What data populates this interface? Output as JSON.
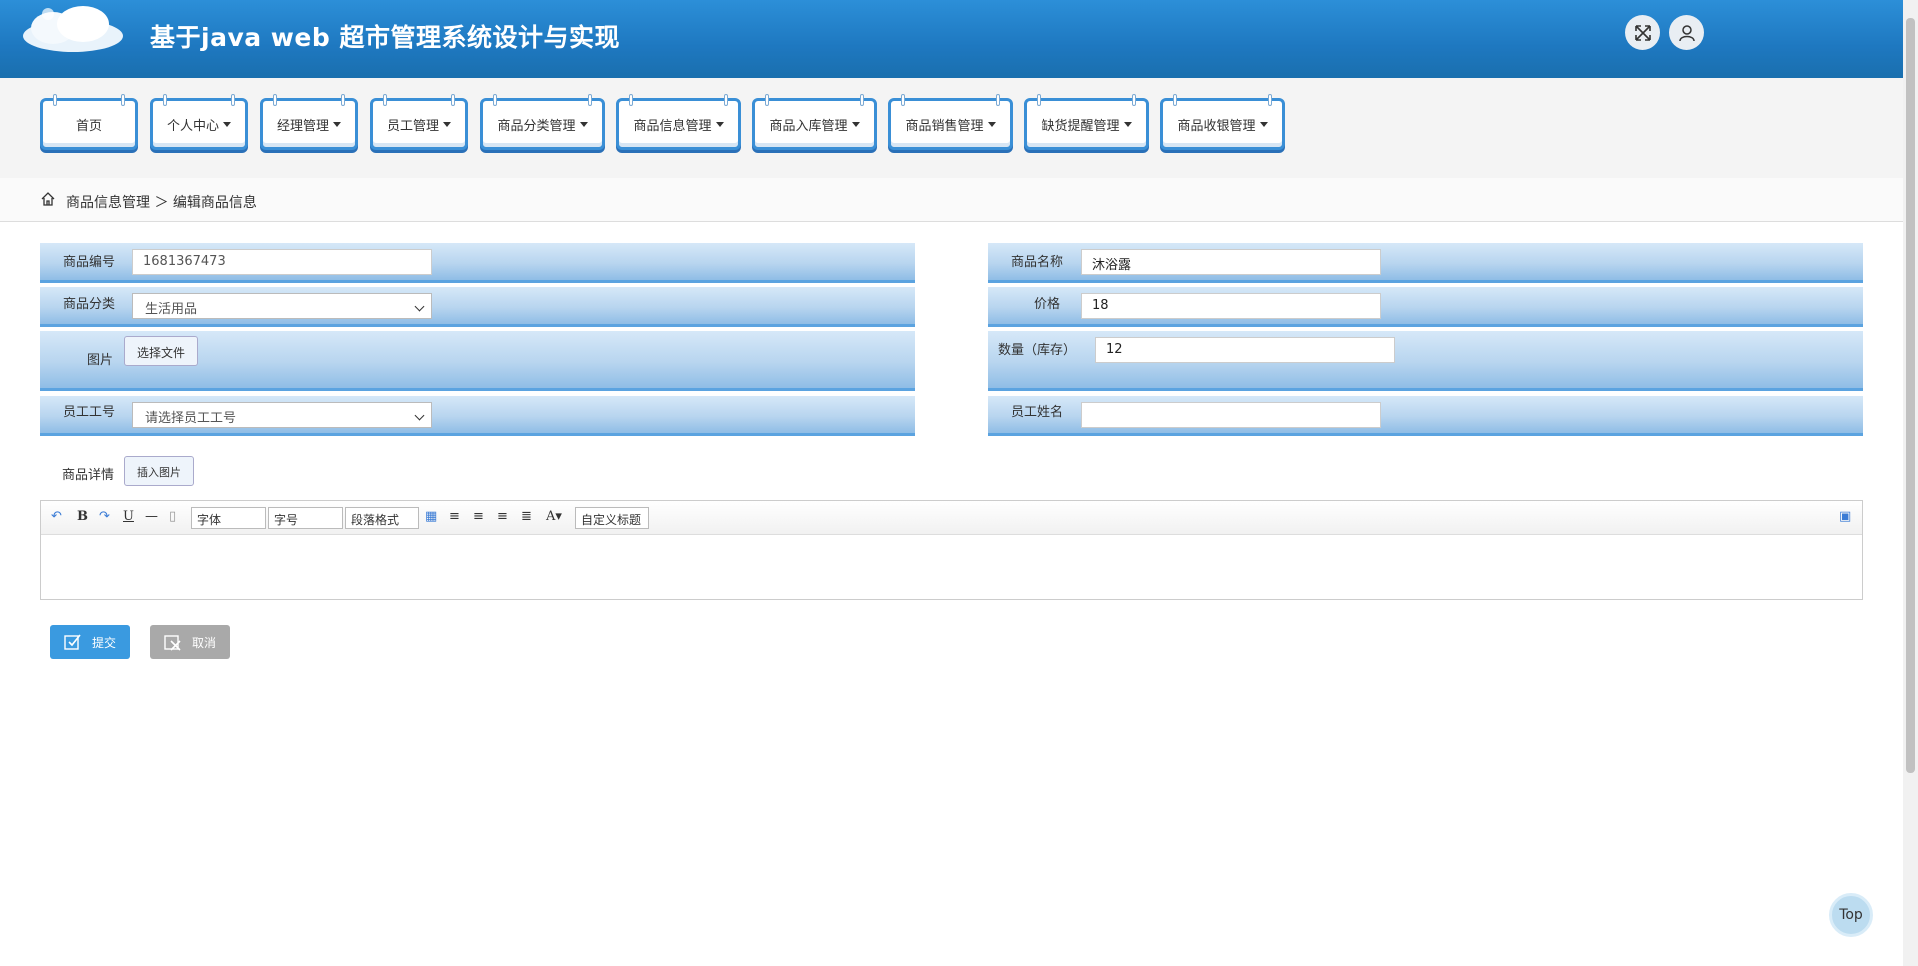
{
  "header": {
    "title": "基于java web 超市管理系统设计与实现"
  },
  "nav": {
    "items": [
      {
        "label": "首页",
        "dropdown": false
      },
      {
        "label": "个人中心",
        "dropdown": true
      },
      {
        "label": "经理管理",
        "dropdown": true
      },
      {
        "label": "员工管理",
        "dropdown": true
      },
      {
        "label": "商品分类管理",
        "dropdown": true
      },
      {
        "label": "商品信息管理",
        "dropdown": true
      },
      {
        "label": "商品入库管理",
        "dropdown": true
      },
      {
        "label": "商品销售管理",
        "dropdown": true
      },
      {
        "label": "缺货提醒管理",
        "dropdown": true
      },
      {
        "label": "商品收银管理",
        "dropdown": true
      }
    ]
  },
  "breadcrumb": {
    "text": "商品信息管理 ＞ 编辑商品信息"
  },
  "form": {
    "code_label": "商品编号",
    "code_value": "1681367473",
    "name_label": "商品名称",
    "name_value": "沐浴露",
    "category_label": "商品分类",
    "category_value": "生活用品",
    "price_label": "价格",
    "price_value": "18",
    "image_label": "图片",
    "file_button": "选择文件",
    "qty_label": "数量（库存）",
    "qty_value": "12",
    "staffno_label": "员工工号",
    "staffno_value": "请选择员工工号",
    "staffname_label": "员工姓名",
    "staffname_value": "",
    "detail_label": "商品详情",
    "insert_image": "插入图片"
  },
  "editor": {
    "font": "字体",
    "size": "字号",
    "paragraph": "段落格式",
    "custom": "自定义标题"
  },
  "actions": {
    "submit": "提交",
    "cancel": "取消"
  },
  "top_button": "Top",
  "colors": {
    "header": "#1e78c0",
    "submit": "#3a9ae0",
    "cancel": "#a9a9a9"
  }
}
